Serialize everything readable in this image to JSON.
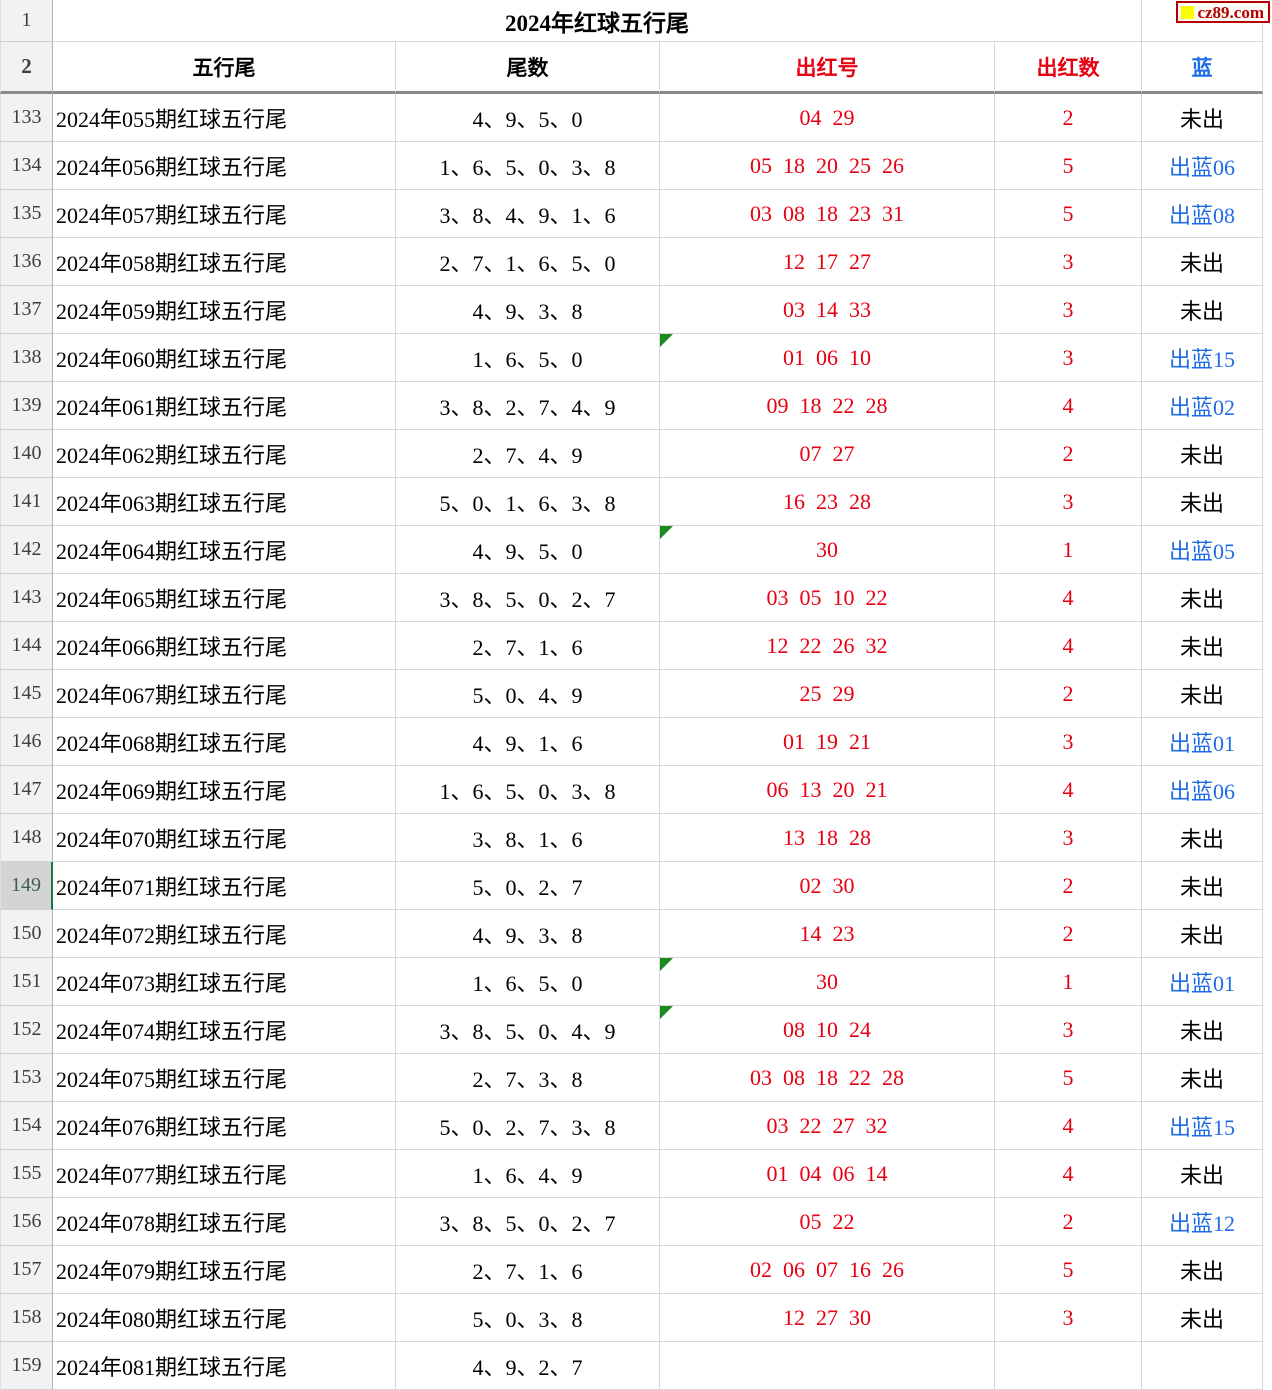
{
  "logo": {
    "text": "cz89.com",
    "square_color": "#ffff00",
    "text_color": "#b50000",
    "border_color": "#b50000"
  },
  "table": {
    "title": "2024年红球五行尾",
    "title_row_number": "1",
    "header_row_number": "2",
    "headers": [
      "五行尾",
      "尾数",
      "出红号",
      "出红数",
      "蓝"
    ],
    "selection": {
      "selected_row": "149"
    },
    "rows": [
      {
        "num": "133",
        "name": "2024年055期红球五行尾",
        "tails": "4、9、5、0",
        "reds": "04  29",
        "count": "2",
        "blue": "未出",
        "flag": false
      },
      {
        "num": "134",
        "name": "2024年056期红球五行尾",
        "tails": "1、6、5、0、3、8",
        "reds": "05  18  20  25  26",
        "count": "5",
        "blue": "出蓝06",
        "flag": false
      },
      {
        "num": "135",
        "name": "2024年057期红球五行尾",
        "tails": "3、8、4、9、1、6",
        "reds": "03  08  18  23  31",
        "count": "5",
        "blue": "出蓝08",
        "flag": false
      },
      {
        "num": "136",
        "name": "2024年058期红球五行尾",
        "tails": "2、7、1、6、5、0",
        "reds": "12  17  27",
        "count": "3",
        "blue": "未出",
        "flag": false
      },
      {
        "num": "137",
        "name": "2024年059期红球五行尾",
        "tails": "4、9、3、8",
        "reds": "03  14  33",
        "count": "3",
        "blue": "未出",
        "flag": false
      },
      {
        "num": "138",
        "name": "2024年060期红球五行尾",
        "tails": "1、6、5、0",
        "reds": "01  06  10",
        "count": "3",
        "blue": "出蓝15",
        "flag": true
      },
      {
        "num": "139",
        "name": "2024年061期红球五行尾",
        "tails": "3、8、2、7、4、9",
        "reds": "09  18  22  28",
        "count": "4",
        "blue": "出蓝02",
        "flag": false
      },
      {
        "num": "140",
        "name": "2024年062期红球五行尾",
        "tails": "2、7、4、9",
        "reds": "07  27",
        "count": "2",
        "blue": "未出",
        "flag": false
      },
      {
        "num": "141",
        "name": "2024年063期红球五行尾",
        "tails": "5、0、1、6、3、8",
        "reds": "16  23  28",
        "count": "3",
        "blue": "未出",
        "flag": false
      },
      {
        "num": "142",
        "name": "2024年064期红球五行尾",
        "tails": "4、9、5、0",
        "reds": "30",
        "count": "1",
        "blue": "出蓝05",
        "flag": true
      },
      {
        "num": "143",
        "name": "2024年065期红球五行尾",
        "tails": "3、8、5、0、2、7",
        "reds": "03  05  10  22",
        "count": "4",
        "blue": "未出",
        "flag": false
      },
      {
        "num": "144",
        "name": "2024年066期红球五行尾",
        "tails": "2、7、1、6",
        "reds": "12  22  26  32",
        "count": "4",
        "blue": "未出",
        "flag": false
      },
      {
        "num": "145",
        "name": "2024年067期红球五行尾",
        "tails": "5、0、4、9",
        "reds": "25  29",
        "count": "2",
        "blue": "未出",
        "flag": false
      },
      {
        "num": "146",
        "name": "2024年068期红球五行尾",
        "tails": "4、9、1、6",
        "reds": "01  19  21",
        "count": "3",
        "blue": "出蓝01",
        "flag": false
      },
      {
        "num": "147",
        "name": "2024年069期红球五行尾",
        "tails": "1、6、5、0、3、8",
        "reds": "06  13  20  21",
        "count": "4",
        "blue": "出蓝06",
        "flag": false
      },
      {
        "num": "148",
        "name": "2024年070期红球五行尾",
        "tails": "3、8、1、6",
        "reds": "13  18  28",
        "count": "3",
        "blue": "未出",
        "flag": false
      },
      {
        "num": "149",
        "name": "2024年071期红球五行尾",
        "tails": "5、0、2、7",
        "reds": "02  30",
        "count": "2",
        "blue": "未出",
        "flag": false
      },
      {
        "num": "150",
        "name": "2024年072期红球五行尾",
        "tails": "4、9、3、8",
        "reds": "14  23",
        "count": "2",
        "blue": "未出",
        "flag": false
      },
      {
        "num": "151",
        "name": "2024年073期红球五行尾",
        "tails": "1、6、5、0",
        "reds": "30",
        "count": "1",
        "blue": "出蓝01",
        "flag": true
      },
      {
        "num": "152",
        "name": "2024年074期红球五行尾",
        "tails": "3、8、5、0、4、9",
        "reds": "08  10  24",
        "count": "3",
        "blue": "未出",
        "flag": true
      },
      {
        "num": "153",
        "name": "2024年075期红球五行尾",
        "tails": "2、7、3、8",
        "reds": "03  08  18  22  28",
        "count": "5",
        "blue": "未出",
        "flag": false
      },
      {
        "num": "154",
        "name": "2024年076期红球五行尾",
        "tails": "5、0、2、7、3、8",
        "reds": "03  22  27  32",
        "count": "4",
        "blue": "出蓝15",
        "flag": false
      },
      {
        "num": "155",
        "name": "2024年077期红球五行尾",
        "tails": "1、6、4、9",
        "reds": "01  04  06  14",
        "count": "4",
        "blue": "未出",
        "flag": false
      },
      {
        "num": "156",
        "name": "2024年078期红球五行尾",
        "tails": "3、8、5、0、2、7",
        "reds": "05  22",
        "count": "2",
        "blue": "出蓝12",
        "flag": false
      },
      {
        "num": "157",
        "name": "2024年079期红球五行尾",
        "tails": "2、7、1、6",
        "reds": "02  06  07  16  26",
        "count": "5",
        "blue": "未出",
        "flag": false
      },
      {
        "num": "158",
        "name": "2024年080期红球五行尾",
        "tails": "5、0、3、8",
        "reds": "12  27  30",
        "count": "3",
        "blue": "未出",
        "flag": false
      },
      {
        "num": "159",
        "name": "2024年081期红球五行尾",
        "tails": "4、9、2、7",
        "reds": "",
        "count": "",
        "blue": "",
        "flag": false
      }
    ]
  },
  "colors": {
    "red": "#e60012",
    "blue": "#1f6ce8",
    "flag_green": "#1a8a1f",
    "selection_green": "#107c41"
  }
}
